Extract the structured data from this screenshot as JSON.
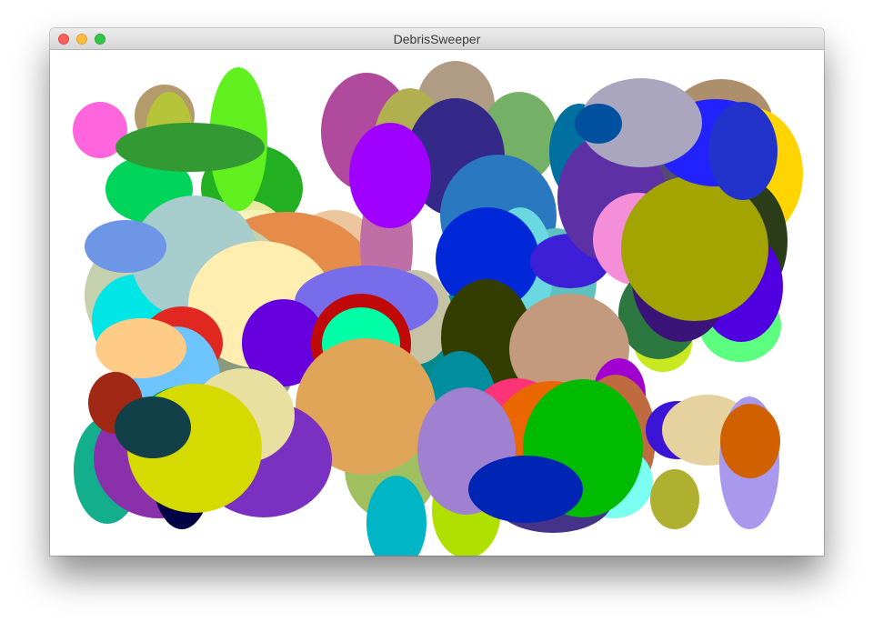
{
  "window": {
    "title": "DebrisSweeper"
  },
  "colors": {
    "background": "#ffffff",
    "ring": "#c00a0a",
    "ring_center": "#00ffa6"
  },
  "game": {
    "debris_count": 94
  }
}
